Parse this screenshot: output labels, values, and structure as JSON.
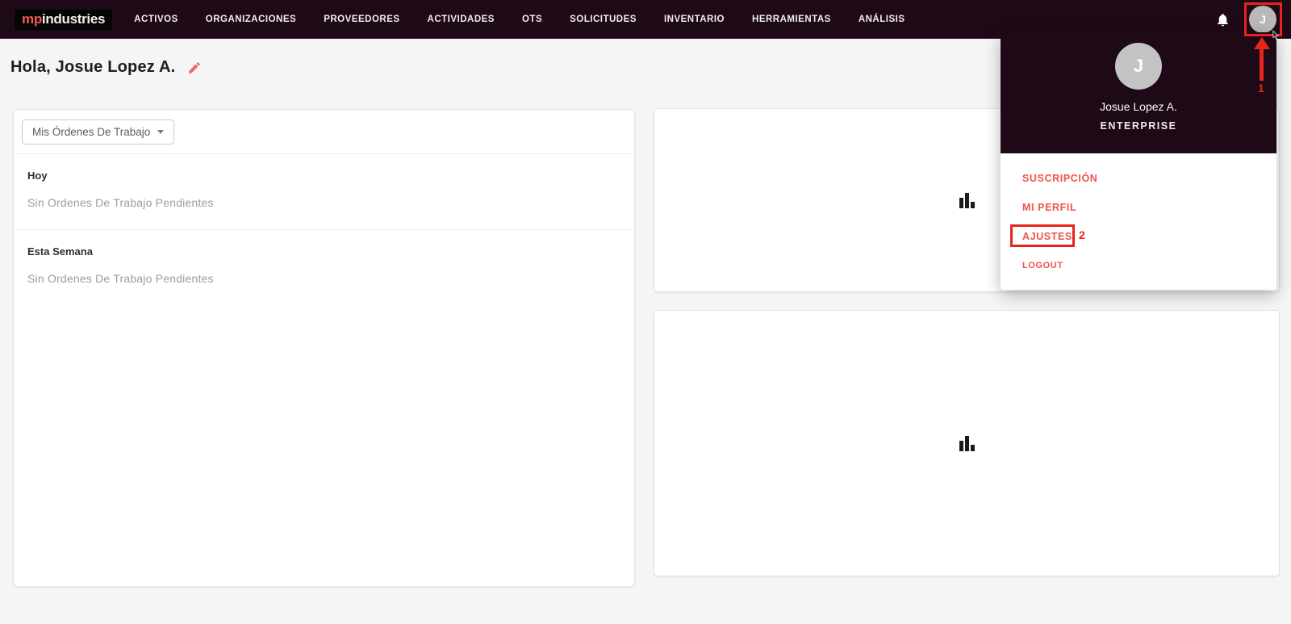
{
  "nav": {
    "logo": {
      "part_red": "mp",
      "part_white": "industries"
    },
    "items": [
      {
        "label": "ACTIVOS"
      },
      {
        "label": "ORGANIZACIONES"
      },
      {
        "label": "PROVEEDORES"
      },
      {
        "label": "ACTIVIDADES"
      },
      {
        "label": "OTS"
      },
      {
        "label": "SOLICITUDES"
      },
      {
        "label": "INVENTARIO"
      },
      {
        "label": "HERRAMIENTAS"
      },
      {
        "label": "ANÁLISIS"
      }
    ],
    "avatar_initial": "J"
  },
  "page": {
    "greeting": "Hola, Josue Lopez A."
  },
  "workorders_card": {
    "filter_label": "Mis Órdenes De Trabajo",
    "sections": [
      {
        "title": "Hoy",
        "empty_text": "Sin Ordenes De Trabajo Pendientes"
      },
      {
        "title": "Esta Semana",
        "empty_text": "Sin Ordenes De Trabajo Pendientes"
      }
    ]
  },
  "user_menu": {
    "avatar_initial": "J",
    "name": "Josue Lopez A.",
    "plan": "ENTERPRISE",
    "items": [
      {
        "label": "SUSCRIPCIÓN"
      },
      {
        "label": "MI PERFIL"
      },
      {
        "label": "AJUSTES"
      },
      {
        "label": "LOGOUT"
      }
    ]
  },
  "annotations": {
    "step1_label": "1",
    "step2_label": "2"
  },
  "colors": {
    "nav_background": "#1e0a17",
    "logo_red": "#ef5a52",
    "menu_link_red": "#f2524b",
    "annotation_red": "#e8231c",
    "page_background": "#f5f5f5"
  }
}
